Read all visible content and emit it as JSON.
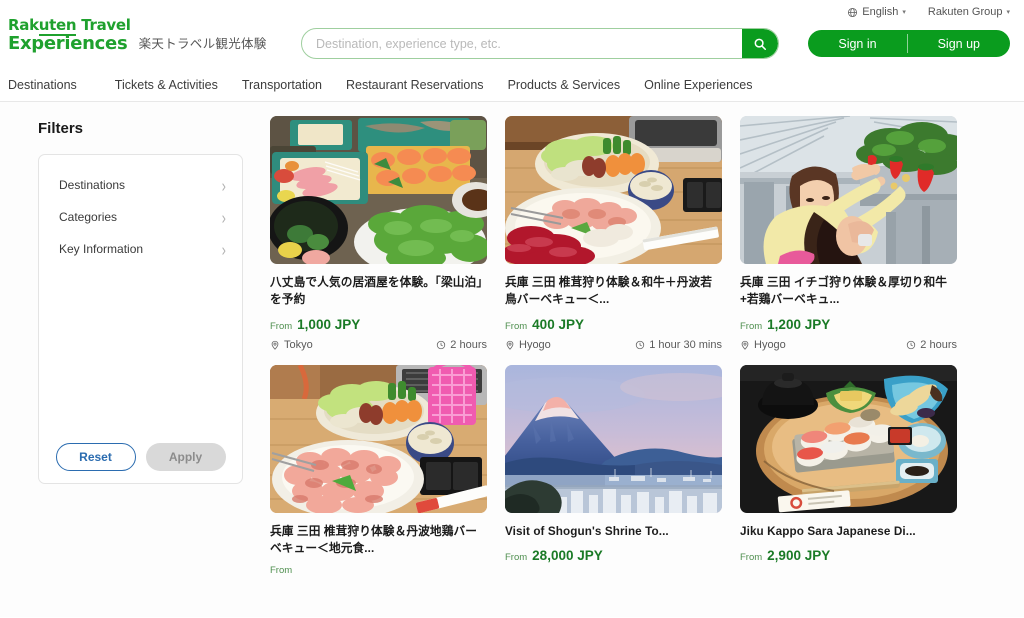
{
  "header": {
    "logo": {
      "line1_a": "Rak",
      "line1_b": "uten",
      "line1_c": " Travel",
      "line2": "Experiences",
      "jp_subtitle": "楽天トラベル観光体験"
    },
    "search": {
      "placeholder": "Destination, experience type, etc.",
      "value": "",
      "icon": "search-icon"
    },
    "utils": [
      {
        "label": "English",
        "icon": "globe-icon",
        "caret": "▾"
      },
      {
        "label": "Rakuten Group",
        "icon": "",
        "caret": "▾"
      }
    ],
    "auth": {
      "sign_in": "Sign in",
      "sign_up": "Sign up"
    },
    "accent_green": "#0a9c1e"
  },
  "nav": {
    "items": [
      "Destinations",
      "Tickets & Activities",
      "Transportation",
      "Restaurant Reservations",
      "Products & Services",
      "Online Experiences"
    ]
  },
  "sidebar": {
    "title": "Filters",
    "filters": [
      {
        "label": "Destinations",
        "chevron": "›"
      },
      {
        "label": "Categories",
        "chevron": "›"
      },
      {
        "label": "Key Information",
        "chevron": "›"
      }
    ],
    "reset_label": "Reset",
    "apply_label": "Apply"
  },
  "results": {
    "cards": [
      {
        "title": "八丈島で人気の居酒屋を体験。「梁山泊」を予約",
        "from_label": "From",
        "price": "1,000 JPY",
        "location": "Tokyo",
        "duration": "2 hours",
        "image": "izakaya-sashimi-sushi-platter"
      },
      {
        "title": "兵庫 三田 椎茸狩り体験＆和牛＋丹波若鳥バーベキュー＜...",
        "from_label": "From",
        "price": "400 JPY",
        "location": "Hyogo",
        "duration": "1 hour 30 mins",
        "image": "bbq-raw-meat-vegetables-table"
      },
      {
        "title": "兵庫 三田 イチゴ狩り体験＆厚切り和牛+若鶏バーベキュ...",
        "from_label": "From",
        "price": "1,200 JPY",
        "location": "Hyogo",
        "duration": "2 hours",
        "image": "strawberry-picking-greenhouse"
      },
      {
        "title": "兵庫 三田 椎茸狩り体験＆丹波地鶏バーベキュー＜地元食...",
        "from_label": "From",
        "price": "",
        "location": "",
        "duration": "",
        "image": "bbq-chicken-plate-pink-basket"
      },
      {
        "title": "Visit of Shogun's Shrine To...",
        "from_label": "From",
        "price": "28,000 JPY",
        "location": "",
        "duration": "",
        "image": "mount-fuji-twilight-bay"
      },
      {
        "title": "Jiku Kappo Sara Japanese Di...",
        "from_label": "From",
        "price": "2,900 JPY",
        "location": "",
        "duration": "",
        "image": "sushi-tray-kaiseki-set"
      }
    ]
  }
}
